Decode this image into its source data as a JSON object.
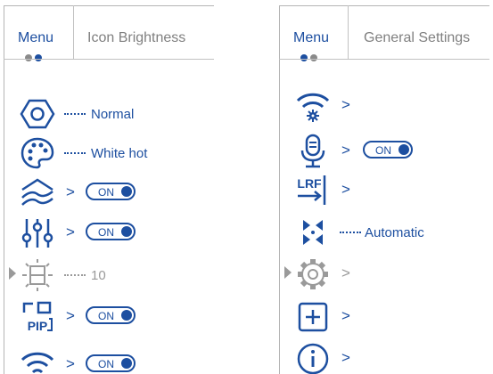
{
  "colors": {
    "accent": "#1d4fa0",
    "muted": "#9a9a9a",
    "text_muted": "#808080"
  },
  "left": {
    "menu_label": "Menu",
    "title": "Icon Brightness",
    "rows": [
      {
        "icon": "hexagon-icon",
        "value": "Normal"
      },
      {
        "icon": "palette-icon",
        "value": "White hot"
      },
      {
        "icon": "waves-icon",
        "chevron": ">",
        "toggle": "ON"
      },
      {
        "icon": "equalizer-icon",
        "chevron": ">",
        "toggle": "ON"
      },
      {
        "icon": "icon-brightness-icon",
        "value": "10",
        "selected": true
      },
      {
        "icon": "pip-icon",
        "chevron": ">",
        "toggle": "ON"
      },
      {
        "icon": "wifi-icon",
        "chevron": ">",
        "toggle": "ON"
      }
    ]
  },
  "right": {
    "menu_label": "Menu",
    "title": "General Settings",
    "rows": [
      {
        "icon": "wifi-settings-icon",
        "chevron": ">"
      },
      {
        "icon": "microphone-icon",
        "chevron": ">",
        "toggle": "ON"
      },
      {
        "icon": "lrf-icon",
        "icon_text": "LRF",
        "chevron": ">"
      },
      {
        "icon": "calibration-arrows-icon",
        "value": "Automatic"
      },
      {
        "icon": "gear-icon",
        "chevron": ">",
        "selected": true
      },
      {
        "icon": "add-icon",
        "chevron": ">"
      },
      {
        "icon": "info-icon",
        "chevron": ">"
      }
    ]
  }
}
